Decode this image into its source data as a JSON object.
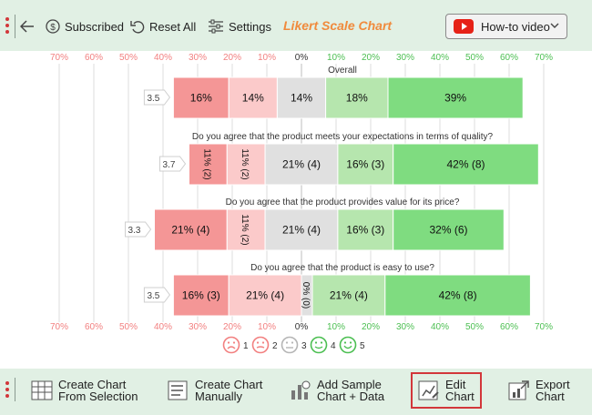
{
  "toolbar": {
    "subscribed": "Subscribed",
    "reset_all": "Reset All",
    "settings": "Settings",
    "title": "Likert Scale Chart",
    "howto": "How-to video"
  },
  "bottom_toolbar": {
    "create_from_selection": [
      "Create Chart",
      "From Selection"
    ],
    "create_manually": [
      "Create Chart",
      "Manually"
    ],
    "add_sample": [
      "Add Sample",
      "Chart + Data"
    ],
    "edit_chart": [
      "Edit",
      "Chart"
    ],
    "export_chart": [
      "Export",
      "Chart"
    ]
  },
  "colors": {
    "accent": "#f08a3c",
    "toolbar_bg": "#e1f0e4",
    "scale": [
      "#f49696",
      "#fbcaca",
      "#e0e0e0",
      "#b6e6ae",
      "#7fdc80"
    ],
    "neg_tick": "#f28080",
    "pos_tick": "#4cbf52"
  },
  "chart_data": {
    "type": "bar",
    "subtype": "diverging-stacked-likert",
    "xlim": [
      -70,
      70
    ],
    "x_ticks": [
      "70%",
      "60%",
      "50%",
      "40%",
      "30%",
      "20%",
      "10%",
      "0%",
      "10%",
      "20%",
      "30%",
      "40%",
      "50%",
      "60%",
      "70%"
    ],
    "tick_values": [
      -70,
      -60,
      -50,
      -40,
      -30,
      -20,
      -10,
      0,
      10,
      20,
      30,
      40,
      50,
      60,
      70
    ],
    "legend": [
      "1",
      "2",
      "3",
      "4",
      "5"
    ],
    "legend_icons": [
      "very-sad-face-icon",
      "sad-face-icon",
      "neutral-face-icon",
      "smile-face-icon",
      "happy-face-icon"
    ],
    "legend_position": "bottom",
    "rows": [
      {
        "question": "Overall",
        "score": "3.5",
        "values": [
          16,
          14,
          14,
          18,
          39
        ],
        "labels": [
          "16%",
          "14%",
          "14%",
          "18%",
          "39%"
        ],
        "rotated": [
          false,
          false,
          false,
          false,
          false
        ]
      },
      {
        "question": "Do you agree that the product meets your expectations in terms of quality?",
        "score": "3.7",
        "values": [
          11,
          11,
          21,
          16,
          42
        ],
        "labels": [
          "11% (2)",
          "11% (2)",
          "21% (4)",
          "16% (3)",
          "42% (8)"
        ],
        "rotated": [
          true,
          true,
          false,
          false,
          false
        ]
      },
      {
        "question": "Do you agree that the product provides value for its price?",
        "score": "3.3",
        "values": [
          21,
          11,
          21,
          16,
          32
        ],
        "labels": [
          "21% (4)",
          "11% (2)",
          "21% (4)",
          "16% (3)",
          "32% (6)"
        ],
        "rotated": [
          false,
          true,
          false,
          false,
          false
        ]
      },
      {
        "question": "Do you agree that the product is easy to use?",
        "score": "3.5",
        "values": [
          16,
          21,
          0,
          21,
          42
        ],
        "labels": [
          "16% (3)",
          "21% (4)",
          "0% (0)",
          "21% (4)",
          "42% (8)"
        ],
        "rotated": [
          false,
          false,
          true,
          false,
          false
        ]
      }
    ]
  }
}
